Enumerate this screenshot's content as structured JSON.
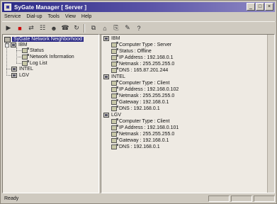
{
  "window": {
    "title": "SyGate Manager [ Server ]"
  },
  "menu": [
    "Service",
    "Dial-up",
    "Tools",
    "View",
    "Help"
  ],
  "toolbar": {
    "left": [
      "play-icon",
      "stop-icon",
      "connect-icon",
      "properties-icon",
      "users-icon",
      "dialup-icon",
      "refresh-icon"
    ],
    "right": [
      "copy-icon",
      "network-icon",
      "paste-icon",
      "edit-icon",
      "help-icon"
    ]
  },
  "tree": {
    "root": "SyGate Network Neighborhood",
    "nodes": [
      {
        "label": "IBM",
        "children": [
          "Status",
          "Network Information",
          "Log List"
        ]
      },
      {
        "label": "INTEL",
        "children": []
      },
      {
        "label": "LGV",
        "children": []
      }
    ]
  },
  "details": [
    {
      "host": "IBM",
      "lines": [
        "Computer Type : Server",
        "Status : Offline",
        "IP Address : 192.168.0.1",
        "Netmask : 255.255.255.0",
        "DNS : 165.87.201.244"
      ]
    },
    {
      "host": "INTEL",
      "lines": [
        "Computer Type : Client",
        "IP Address : 192.168.0.102",
        "Netmask : 255.255.255.0",
        "Gateway : 192.168.0.1",
        "DNS : 192.168.0.1"
      ]
    },
    {
      "host": "LGV",
      "lines": [
        "Computer Type : Client",
        "IP Address : 192.168.0.101",
        "Netmask : 255.255.255.0",
        "Gateway : 192.168.0.1",
        "DNS : 192.168.0.1"
      ]
    }
  ],
  "status": {
    "text": "Ready"
  }
}
